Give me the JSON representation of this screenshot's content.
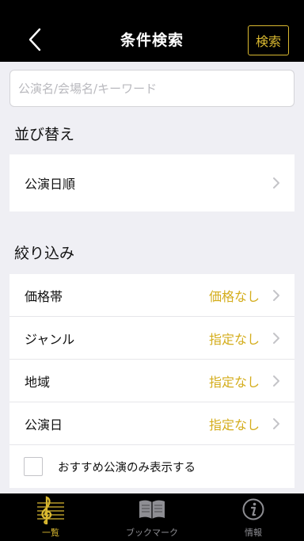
{
  "header": {
    "title": "条件検索",
    "search_button": "検索"
  },
  "search": {
    "placeholder": "公演名/会場名/キーワード",
    "value": ""
  },
  "sort": {
    "heading": "並び替え",
    "items": [
      {
        "label": "公演日順",
        "value": ""
      }
    ]
  },
  "filter": {
    "heading": "絞り込み",
    "items": [
      {
        "label": "価格帯",
        "value": "価格なし"
      },
      {
        "label": "ジャンル",
        "value": "指定なし"
      },
      {
        "label": "地域",
        "value": "指定なし"
      },
      {
        "label": "公演日",
        "value": "指定なし"
      }
    ],
    "recommended_only": {
      "label": "おすすめ公演のみ表示する",
      "checked": false
    }
  },
  "tabbar": {
    "tabs": [
      {
        "label": "一覧",
        "icon": "treble-clef-icon",
        "active": true
      },
      {
        "label": "ブックマーク",
        "icon": "book-icon",
        "active": false
      },
      {
        "label": "情報",
        "icon": "info-icon",
        "active": false
      }
    ]
  },
  "colors": {
    "accent": "#d9b830",
    "value_text": "#d4ad1c",
    "bar_background": "#000000",
    "page_background": "#efeff4"
  }
}
